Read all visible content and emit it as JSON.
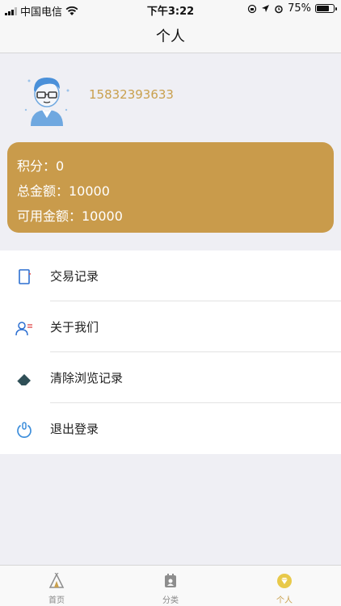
{
  "status_bar": {
    "carrier": "中国电信",
    "time": "下午3:22",
    "battery_percent": "75%",
    "battery_level": 0.75
  },
  "nav": {
    "title": "个人"
  },
  "profile": {
    "phone": "15832393633",
    "points": "积分：0",
    "total_amount": "总金额：10000",
    "available_amount": "可用金额：10000",
    "card_color": "#c99b4b",
    "accent_color": "#c9a04e"
  },
  "menu": {
    "items": [
      {
        "label": "交易记录",
        "icon": "document-icon"
      },
      {
        "label": "关于我们",
        "icon": "person-info-icon"
      },
      {
        "label": "清除浏览记录",
        "icon": "eraser-icon"
      },
      {
        "label": "退出登录",
        "icon": "power-icon"
      }
    ]
  },
  "tabs": [
    {
      "label": "首页",
      "icon": "home-tent-icon",
      "active": false
    },
    {
      "label": "分类",
      "icon": "category-icon",
      "active": false
    },
    {
      "label": "个人",
      "icon": "profile-diamond-icon",
      "active": true
    }
  ]
}
